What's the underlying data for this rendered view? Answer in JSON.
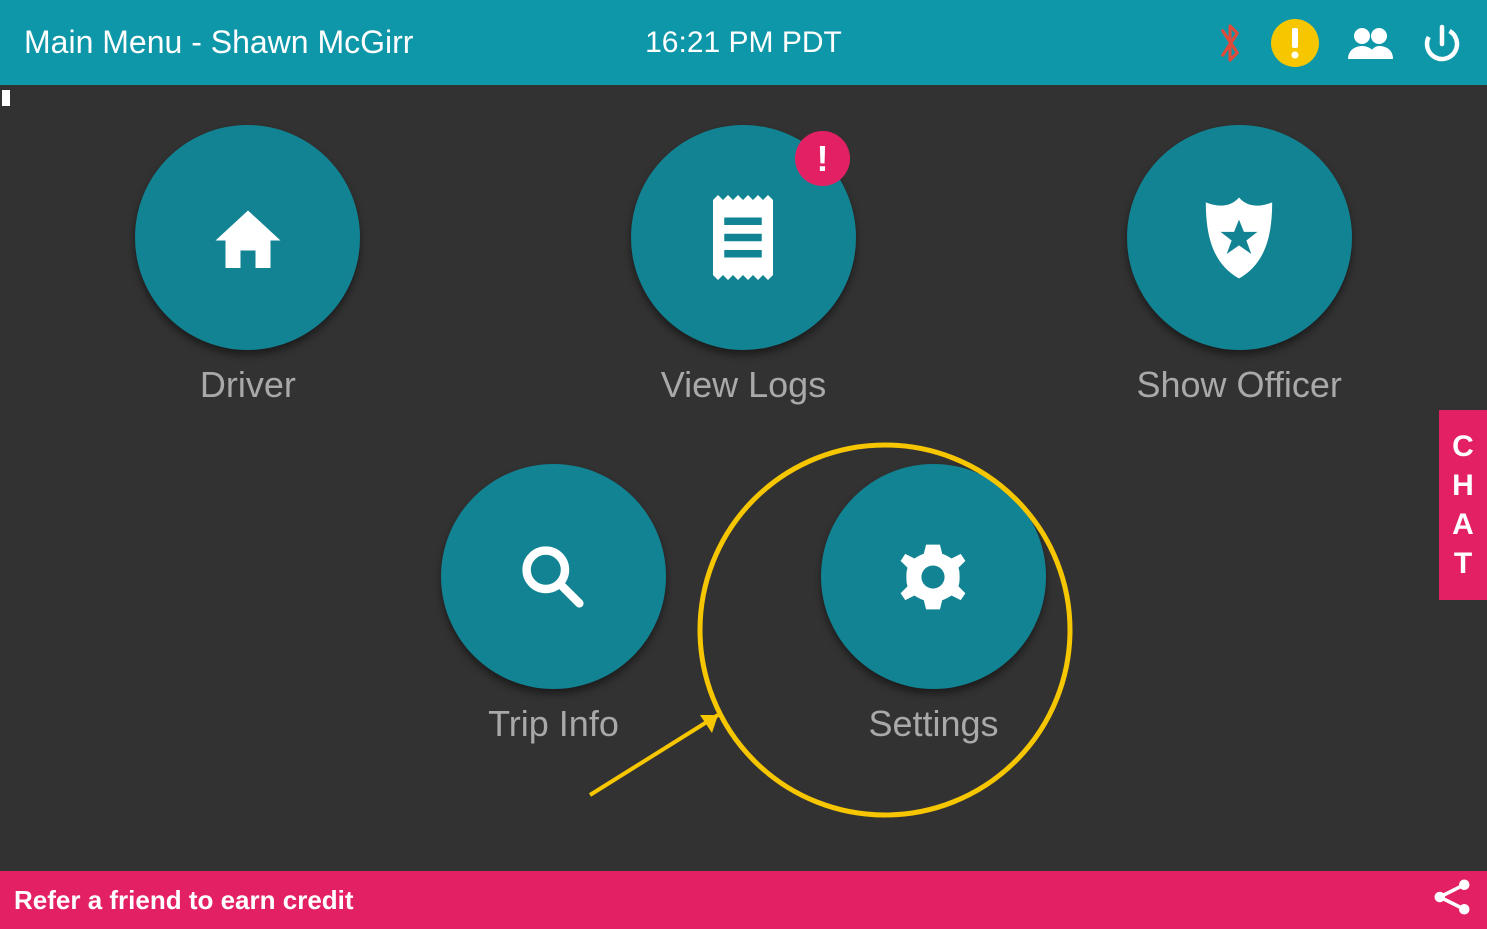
{
  "header": {
    "title": "Main Menu - Shawn McGirr",
    "clock": "16:21 PM PDT"
  },
  "menu": {
    "driver": {
      "label": "Driver"
    },
    "view_logs": {
      "label": "View Logs",
      "badge": "!"
    },
    "show_officer": {
      "label": "Show Officer"
    },
    "trip_info": {
      "label": "Trip Info"
    },
    "settings": {
      "label": "Settings"
    }
  },
  "chat_tab": {
    "c": "C",
    "h": "H",
    "a": "A",
    "t": "T"
  },
  "footer": {
    "text": "Refer a friend to earn credit"
  },
  "colors": {
    "topbar": "#0e97a8",
    "circle": "#118393",
    "accent": "#e32064",
    "highlight": "#f6c700",
    "bg": "#323232",
    "label": "#a9a9a9"
  }
}
